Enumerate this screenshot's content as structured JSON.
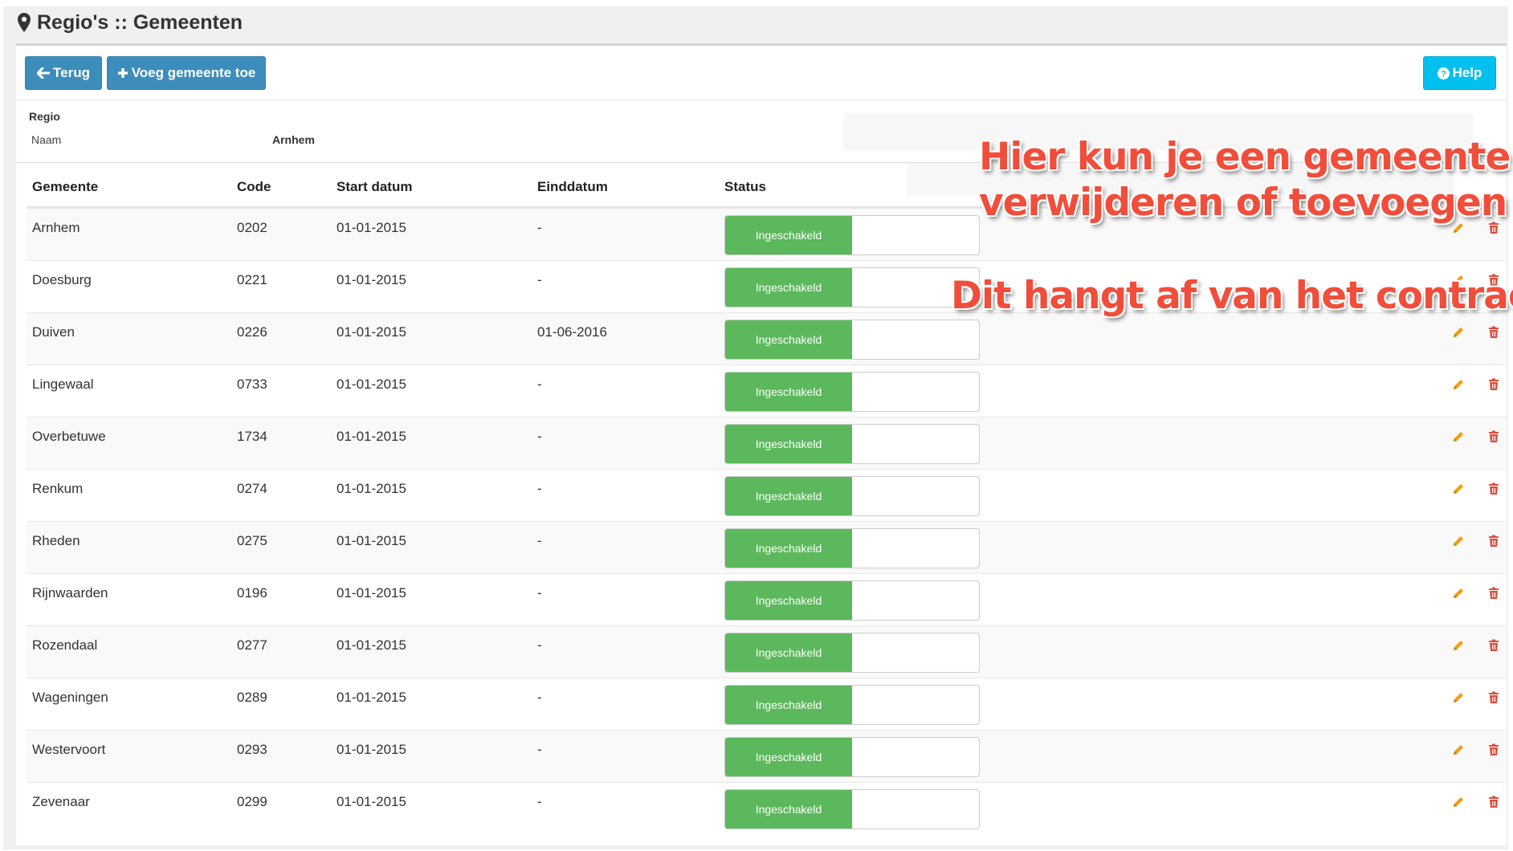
{
  "page": {
    "title": "Regio's :: Gemeenten"
  },
  "toolbar": {
    "back_label": "Terug",
    "add_label": "Voeg gemeente toe",
    "help_label": "Help"
  },
  "regio": {
    "section_title": "Regio",
    "name_label": "Naam",
    "name_value": "Arnhem"
  },
  "table": {
    "headers": {
      "gemeente": "Gemeente",
      "code": "Code",
      "start": "Start datum",
      "end": "Einddatum",
      "status": "Status"
    },
    "rows": [
      {
        "gemeente": "Arnhem",
        "code": "0202",
        "start": "01-01-2015",
        "end": "-",
        "status": "Ingeschakeld"
      },
      {
        "gemeente": "Doesburg",
        "code": "0221",
        "start": "01-01-2015",
        "end": "-",
        "status": "Ingeschakeld"
      },
      {
        "gemeente": "Duiven",
        "code": "0226",
        "start": "01-01-2015",
        "end": "01-06-2016",
        "status": "Ingeschakeld"
      },
      {
        "gemeente": "Lingewaal",
        "code": "0733",
        "start": "01-01-2015",
        "end": "-",
        "status": "Ingeschakeld"
      },
      {
        "gemeente": "Overbetuwe",
        "code": "1734",
        "start": "01-01-2015",
        "end": "-",
        "status": "Ingeschakeld"
      },
      {
        "gemeente": "Renkum",
        "code": "0274",
        "start": "01-01-2015",
        "end": "-",
        "status": "Ingeschakeld"
      },
      {
        "gemeente": "Rheden",
        "code": "0275",
        "start": "01-01-2015",
        "end": "-",
        "status": "Ingeschakeld"
      },
      {
        "gemeente": "Rijnwaarden",
        "code": "0196",
        "start": "01-01-2015",
        "end": "-",
        "status": "Ingeschakeld"
      },
      {
        "gemeente": "Rozendaal",
        "code": "0277",
        "start": "01-01-2015",
        "end": "-",
        "status": "Ingeschakeld"
      },
      {
        "gemeente": "Wageningen",
        "code": "0289",
        "start": "01-01-2015",
        "end": "-",
        "status": "Ingeschakeld"
      },
      {
        "gemeente": "Westervoort",
        "code": "0293",
        "start": "01-01-2015",
        "end": "-",
        "status": "Ingeschakeld"
      },
      {
        "gemeente": "Zevenaar",
        "code": "0299",
        "start": "01-01-2015",
        "end": "-",
        "status": "Ingeschakeld"
      }
    ]
  },
  "annotations": {
    "line1": "Hier kun je een gemeente",
    "line2": "verwijderen of toevoegen",
    "line3": "Dit hangt af van het contract"
  },
  "icons": {
    "header": "map-marker-icon",
    "back": "arrow-left-icon",
    "add": "plus-icon",
    "help": "question-circle-icon",
    "edit": "pencil-icon",
    "delete": "trash-icon"
  },
  "colors": {
    "primary": "#3c8dbc",
    "help": "#00c0ef",
    "status_on": "#5cb85c",
    "edit": "#f39c12",
    "delete": "#dd4b39",
    "annotation": "#f04e3b"
  }
}
